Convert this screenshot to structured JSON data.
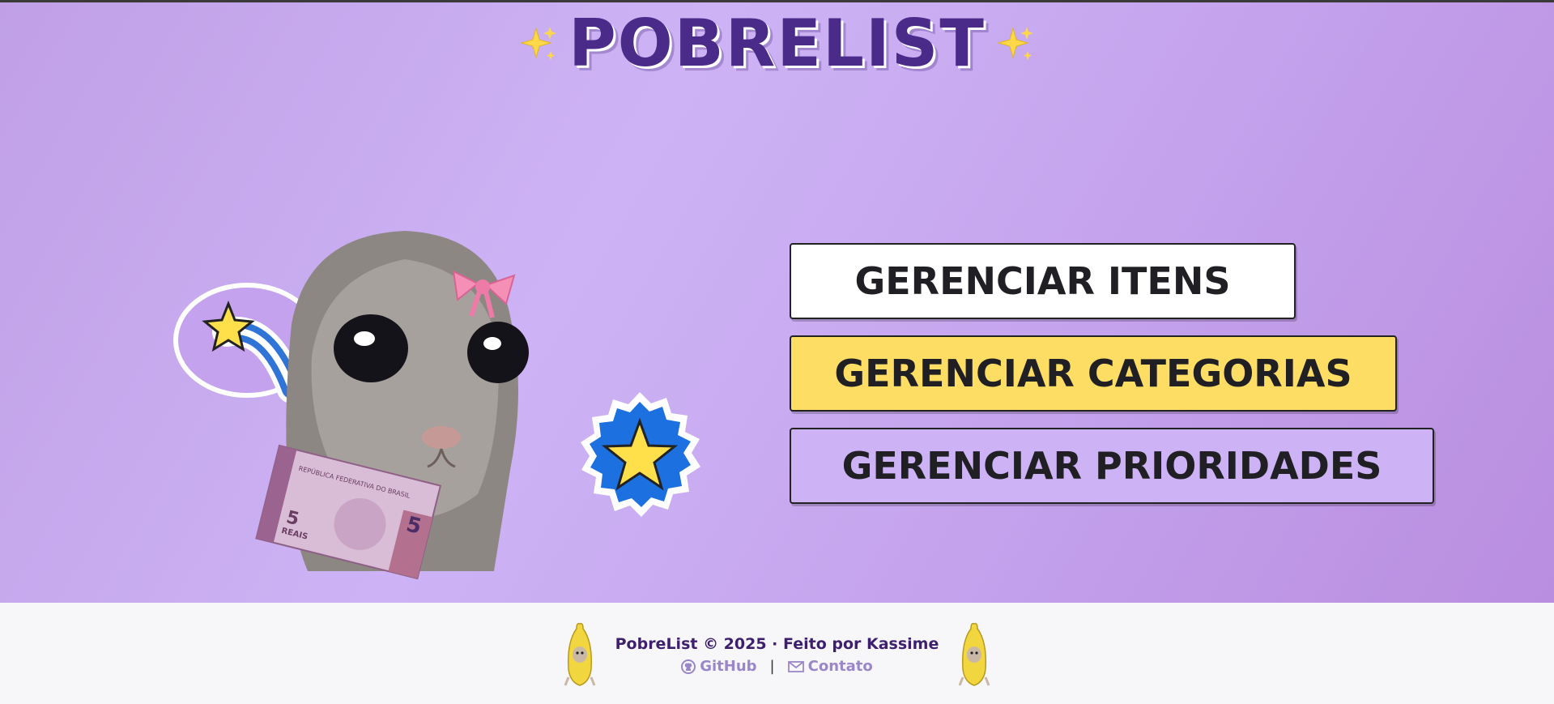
{
  "header": {
    "title": "POBRELIST",
    "sparkle_icon": "sparkles-icon"
  },
  "menu": {
    "items": [
      {
        "label": "GERENCIAR ITENS",
        "color": "#ffffff"
      },
      {
        "label": "GERENCIAR CATEGORIAS",
        "color": "#fddd63"
      },
      {
        "label": "GERENCIAR PRIORIDADES",
        "color": "#cdb3f5"
      }
    ]
  },
  "illustration": {
    "banknote_text": "5",
    "banknote_caption": "REAIS",
    "banknote_header": "REPÚBLICA FEDERATIVA DO BRASIL"
  },
  "footer": {
    "copyright": "PobreList © 2025 · Feito por Kassime",
    "github_label": "GitHub",
    "contact_label": "Contato",
    "separator": "|"
  },
  "colors": {
    "title": "#4b2b8a",
    "background_start": "#c09fe6",
    "footer_bg": "#f7f7fa",
    "footer_text": "#3e1f6e",
    "footer_link": "#9a86c9"
  }
}
